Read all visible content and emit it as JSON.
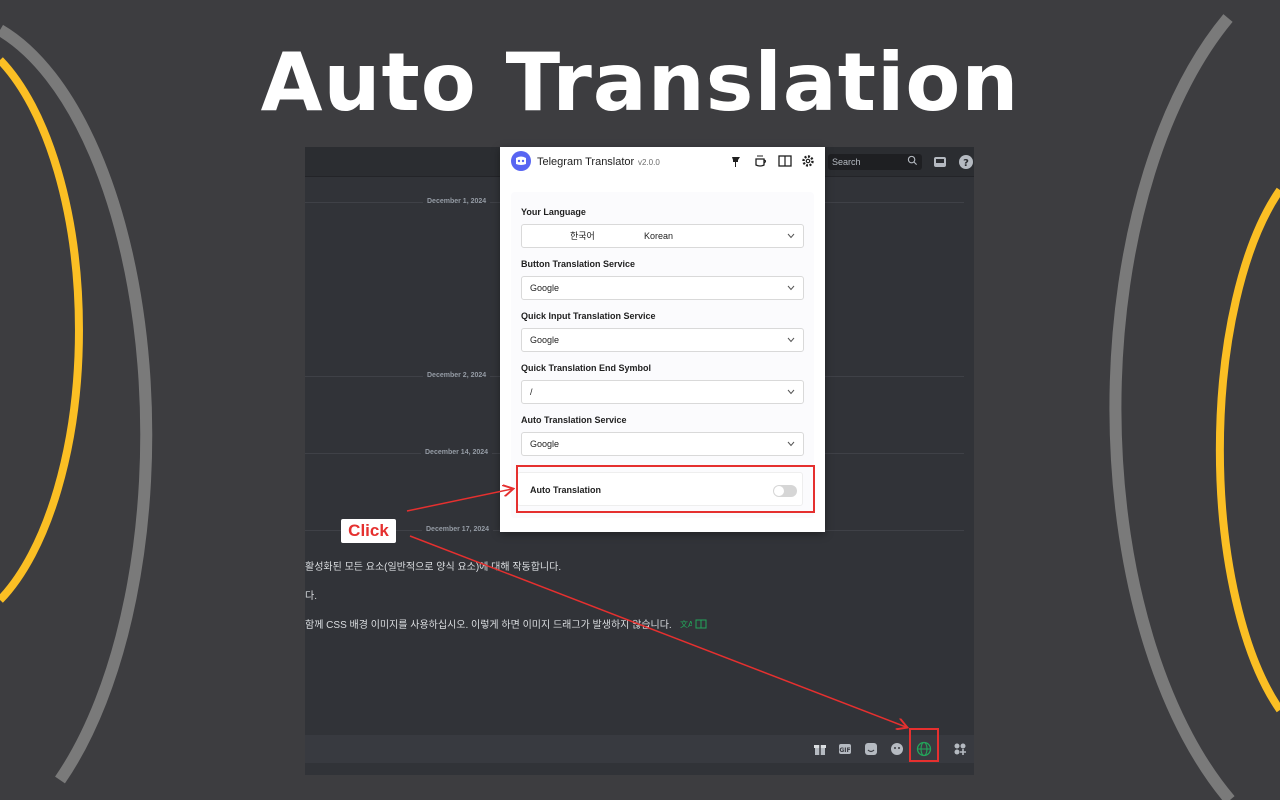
{
  "hero": {
    "title": "Auto Translation"
  },
  "colors": {
    "accent_yellow": "#fbbf24",
    "arc_gray": "#7a7a7a",
    "annotation_red": "#e5302f",
    "brand_blurple": "#5865f2"
  },
  "app": {
    "search_placeholder": "Search",
    "dates": [
      "December 1, 2024",
      "December 2, 2024",
      "December 14, 2024",
      "December 17, 2024"
    ],
    "messages": [
      "활성화된 모든 요소(일반적으로 양식 요소)에 대해 작동합니다.",
      "다.",
      "함께 CSS 배경 이미지를 사용하십시오. 이렇게 하면 이미지 드래그가 발생하지 않습니다."
    ],
    "composer_icons": [
      "gift-icon",
      "gif-icon",
      "sticker-icon",
      "emoji-icon",
      "globe-icon",
      "apps-icon"
    ]
  },
  "panel": {
    "title": "Telegram Translator",
    "version": "v2.0.0",
    "fields": [
      {
        "label": "Your Language",
        "value_native": "한국어",
        "value": "Korean"
      },
      {
        "label": "Button Translation Service",
        "value": "Google"
      },
      {
        "label": "Quick Input Translation Service",
        "value": "Google"
      },
      {
        "label": "Quick Translation End Symbol",
        "value": "/"
      },
      {
        "label": "Auto Translation Service",
        "value": "Google"
      }
    ],
    "toggle": {
      "label": "Auto Translation",
      "enabled": false
    }
  },
  "annotation": {
    "click_label": "Click"
  }
}
